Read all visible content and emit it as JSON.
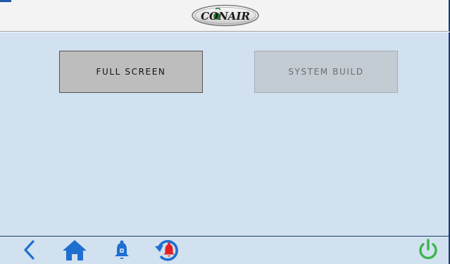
{
  "header": {
    "logo_text": "CONAIR",
    "accent_color": "#1e5aa8"
  },
  "main": {
    "buttons": [
      {
        "label": "FULL SCREEN",
        "state": "enabled"
      },
      {
        "label": "SYSTEM BUILD",
        "state": "disabled"
      }
    ]
  },
  "footer": {
    "icons": [
      "back-chevron-icon",
      "home-icon",
      "alarm-bell-icon",
      "alarm-history-icon",
      "power-icon"
    ],
    "colors": {
      "nav": "#1e6fd0",
      "alarm": "#e32020",
      "power": "#39b54a"
    }
  }
}
